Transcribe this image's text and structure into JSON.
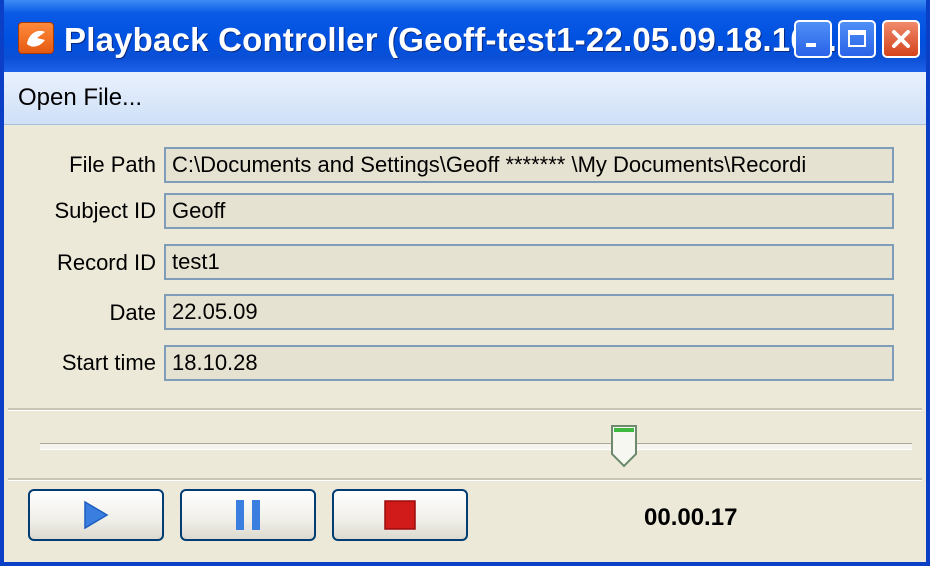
{
  "window": {
    "title": "Playback Controller (Geoff-test1-22.05.09.18.10....",
    "buttons": [
      "minimize-icon",
      "maximize-icon",
      "close-icon"
    ]
  },
  "menu": {
    "open_file": "Open File..."
  },
  "fields": {
    "file_path": {
      "label": "File Path",
      "value": "C:\\Documents and Settings\\Geoff  ******* \\My Documents\\Recordi"
    },
    "subject_id": {
      "label": "Subject ID",
      "value": "Geoff"
    },
    "record_id": {
      "label": "Record ID",
      "value": "test1"
    },
    "date": {
      "label": "Date",
      "value": "22.05.09"
    },
    "start_time": {
      "label": "Start time",
      "value": "18.10.28"
    }
  },
  "playback": {
    "position_fraction": 0.67,
    "time": "00.00.17",
    "controls": [
      "play-icon",
      "pause-icon",
      "stop-icon"
    ]
  },
  "colors": {
    "title_bar": "#0051e0",
    "play": "#3a7fe0",
    "stop": "#d11a1a",
    "field_border": "#7f9db9"
  }
}
